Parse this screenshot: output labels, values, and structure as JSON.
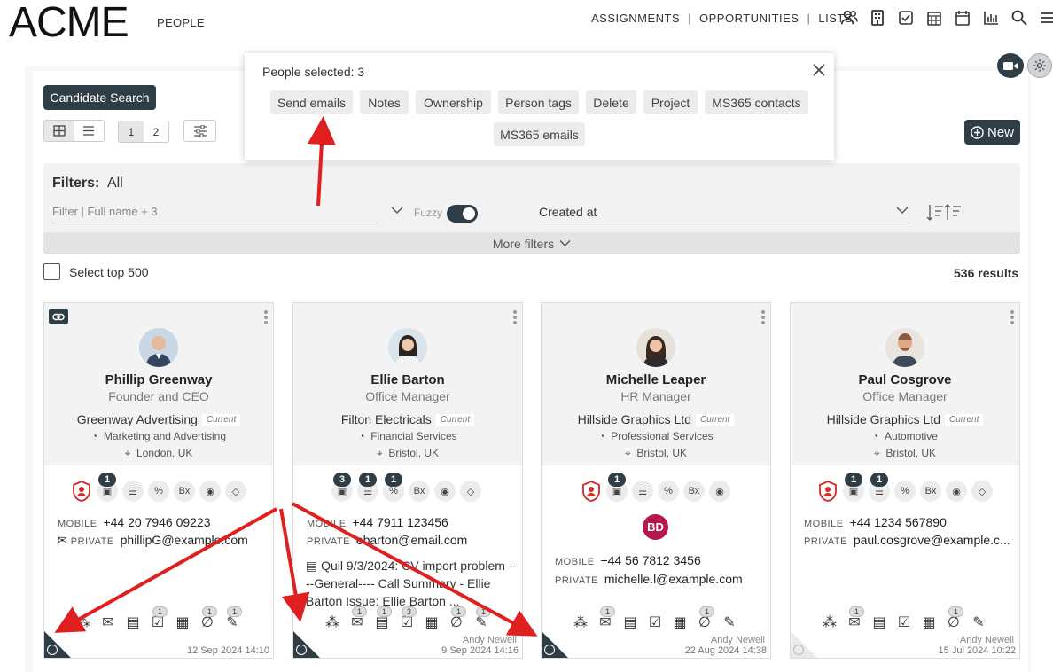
{
  "header": {
    "logo_text": "ACME",
    "section": "PEOPLE",
    "nav": [
      "ASSIGNMENTS",
      "OPPORTUNITIES",
      "LISTS"
    ],
    "icons": [
      "people-icon",
      "building-icon",
      "checkbox-icon",
      "calendar-grid-icon",
      "calendar-icon",
      "bar-chart-icon",
      "search-icon",
      "menu-icon"
    ]
  },
  "toolbar": {
    "candidate_search": "Candidate Search",
    "pages": [
      "1",
      "2"
    ],
    "new_label": "New"
  },
  "selection_popup": {
    "title": "People selected: 3",
    "buttons": [
      "Send emails",
      "Notes",
      "Ownership",
      "Person tags",
      "Delete",
      "Project",
      "MS365 contacts",
      "MS365 emails"
    ]
  },
  "filters": {
    "label": "Filters:",
    "value": "All",
    "search_placeholder": "Filter | Full name + 3",
    "fuzzy_label": "Fuzzy",
    "sort_by": "Created at",
    "more_filters": "More filters"
  },
  "list": {
    "select_top": "Select top 500",
    "results": "536 results"
  },
  "cards": [
    {
      "name": "Phillip Greenway",
      "role": "Founder and CEO",
      "company": "Greenway Advertising",
      "current": "Current",
      "industry": "Marketing and Advertising",
      "location": "London, UK",
      "mobile_label": "MOBILE",
      "mobile": "+44 20 7946 09223",
      "private_label": "PRIVATE",
      "email": "phillipG@example.com",
      "owner": "",
      "date": "12 Sep 2024 14:10",
      "action_counts": [
        "1"
      ],
      "foot_counts": [
        "1",
        "1",
        "1"
      ]
    },
    {
      "name": "Ellie Barton",
      "role": "Office Manager",
      "company": "Filton Electricals",
      "current": "Current",
      "industry": "Financial Services",
      "location": "Bristol, UK",
      "mobile_label": "MOBILE",
      "mobile": "+44 7911 123456",
      "private_label": "PRIVATE",
      "email": "ebarton@email.com",
      "note": "Quil 9/3/2024: CV import problem ----General---- Call Summary - Ellie Barton Issue: Ellie Barton ...",
      "owner": "Andy Newell",
      "date": "9 Sep 2024 14:16",
      "action_counts": [
        "3",
        "1",
        "1"
      ],
      "foot_counts": [
        "1",
        "1",
        "3",
        "1",
        "1"
      ]
    },
    {
      "name": "Michelle Leaper",
      "role": "HR Manager",
      "company": "Hillside Graphics Ltd",
      "current": "Current",
      "industry": "Professional Services",
      "location": "Bristol, UK",
      "initials": "BD",
      "mobile_label": "MOBILE",
      "mobile": "+44 56 7812 3456",
      "private_label": "PRIVATE",
      "email": "michelle.l@example.com",
      "owner": "Andy Newell",
      "date": "22 Aug 2024 14:38",
      "action_counts": [
        "1"
      ],
      "foot_counts": [
        "1",
        "1"
      ]
    },
    {
      "name": "Paul Cosgrove",
      "role": "Office Manager",
      "company": "Hillside Graphics Ltd",
      "current": "Current",
      "industry": "Automotive",
      "location": "Bristol, UK",
      "mobile_label": "MOBILE",
      "mobile": "+44 1234 567890",
      "private_label": "PRIVATE",
      "email": "paul.cosgrove@example.c...",
      "owner": "Andy Newell",
      "date": "15 Jul 2024 10:22",
      "action_counts": [
        "1",
        "1"
      ],
      "foot_counts": [
        "1",
        "1"
      ]
    }
  ],
  "colors": {
    "brand_dark": "#2f3e46",
    "annotation_red": "#e02020",
    "initials_bg": "#b5184f"
  }
}
